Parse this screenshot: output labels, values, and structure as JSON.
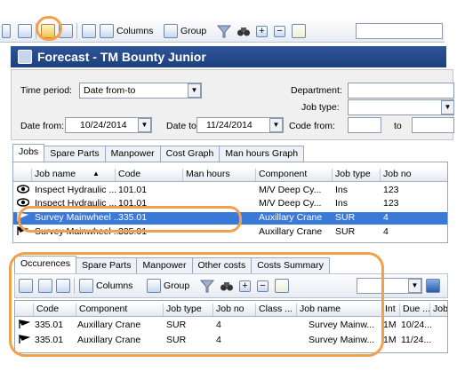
{
  "toolbar": {
    "columns_label": "Columns",
    "group_label": "Group"
  },
  "window": {
    "title": "Forecast - TM Bounty Junior"
  },
  "filters": {
    "time_period_label": "Time period:",
    "time_period_value": "Date from-to",
    "department_label": "Department:",
    "job_type_label": "Job type:",
    "date_from_label": "Date from:",
    "date_from_value": "10/24/2014",
    "date_to_label": "Date to:",
    "date_to_value": "11/24/2014",
    "code_from_label": "Code from:",
    "to_label": "to"
  },
  "top_tabs": [
    "Jobs",
    "Spare Parts",
    "Manpower",
    "Cost Graph",
    "Man hours Graph"
  ],
  "jobs_grid": {
    "columns": [
      "Job name",
      "Code",
      "Man hours",
      "Component",
      "Job type",
      "Job no"
    ],
    "rows": [
      {
        "icon": "eye-icon",
        "job_name": "Inspect Hydraulic ...",
        "code": "101.01",
        "man_hours": "",
        "component": "M/V Deep Cy...",
        "job_type": "Ins",
        "job_no": "123"
      },
      {
        "icon": "eye-icon",
        "job_name": "Inspect Hydraulic ...",
        "code": "101.01",
        "man_hours": "",
        "component": "M/V Deep Cy...",
        "job_type": "Ins",
        "job_no": "123"
      },
      {
        "icon": "flag-icon",
        "job_name": "Survey Mainwheel ...",
        "code": "335.01",
        "man_hours": "",
        "component": "Auxillary Crane",
        "job_type": "SUR",
        "job_no": "4",
        "selected": true
      },
      {
        "icon": "flag-icon",
        "job_name": "Survey Mainwheel ...",
        "code": "335.01",
        "man_hours": "",
        "component": "Auxillary Crane",
        "job_type": "SUR",
        "job_no": "4"
      }
    ]
  },
  "bottom_tabs": [
    "Occurences",
    "Spare Parts",
    "Manpower",
    "Other costs",
    "Costs Summary"
  ],
  "occ_grid": {
    "columns": [
      "Code",
      "Component",
      "Job type",
      "Job no",
      "Class ...",
      "Job name",
      "Int",
      "Due ...",
      "Job"
    ],
    "rows": [
      {
        "code": "335.01",
        "component": "Auxillary Crane",
        "job_type": "SUR",
        "job_no": "4",
        "class": "",
        "job_name": "Survey Mainw...",
        "int": "1M",
        "due": "10/24..."
      },
      {
        "code": "335.01",
        "component": "Auxillary Crane",
        "job_type": "SUR",
        "job_no": "4",
        "class": "",
        "job_name": "Survey Mainw...",
        "int": "1M",
        "due": "11/24..."
      }
    ]
  },
  "colors": {
    "accent": "#3a79d8",
    "highlight": "#f2a04a",
    "title_bg": "#1d3f7d"
  }
}
